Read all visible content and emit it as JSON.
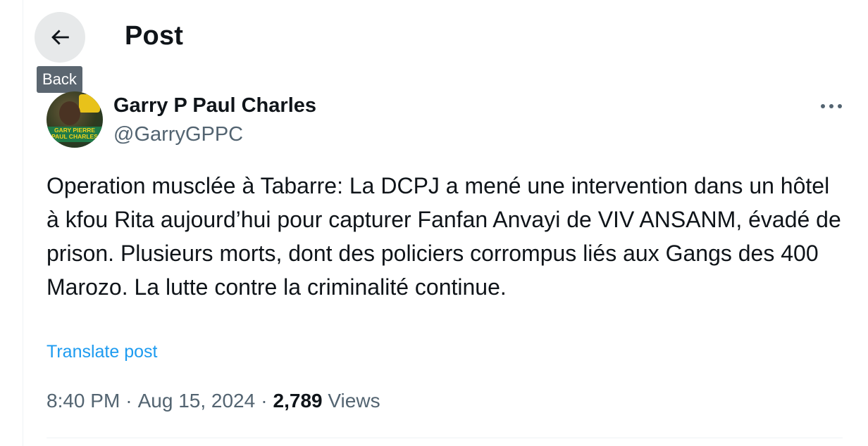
{
  "header": {
    "title": "Post",
    "back_tooltip": "Back",
    "back_icon": "arrow-left-icon"
  },
  "author": {
    "display_name": "Garry P Paul Charles",
    "handle": "@GarryGPPC",
    "avatar_caption": "GARY PIERRE PAUL CHARLES"
  },
  "post": {
    "text": "Operation musclée à Tabarre: La DCPJ a mené une intervention dans un hôtel à kfou Rita aujourd’hui pour capturer Fanfan Anvayi de VIV ANSANM, évadé de prison. Plusieurs morts, dont des policiers corrompus liés aux Gangs des 400 Marozo. La lutte contre la criminalité continue.",
    "translate_label": "Translate post",
    "time": "8:40 PM",
    "separator": "·",
    "date": "Aug 15, 2024",
    "views_count": "2,789",
    "views_label": "Views",
    "more_icon": "more-horizontal-icon"
  },
  "colors": {
    "accent": "#1d9bf0",
    "secondary_text": "#536471",
    "primary_text": "#0f1419"
  }
}
